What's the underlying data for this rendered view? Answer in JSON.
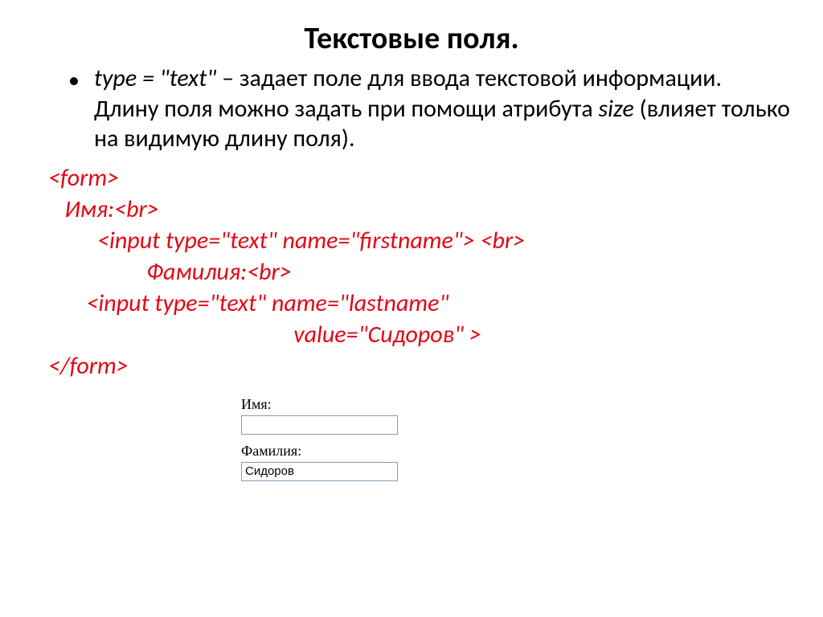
{
  "title": "Текстовые поля.",
  "bullet": {
    "marker": "•",
    "attr": "type = \"text\" ",
    "dash": "– ",
    "text1": "задает поле для ввода текстовой информации. Длину поля можно задать при помощи атрибута ",
    "sizeAttr": "size",
    "text2": " (влияет только на видимую длину поля)."
  },
  "code": {
    "l1": "<form>",
    "l2": "   Имя:<br>",
    "l3": "         <input type=\"text\" name=\"firstname\"> <br>",
    "l4": "                  Фамилия:<br>",
    "l5": "       <input type=\"text\" name=\"lastname\"",
    "l6": "                                             value=\"Сидоров\" >",
    "l7": "</form>"
  },
  "form": {
    "label1": "Имя:",
    "value1": "",
    "label2": "Фамилия:",
    "value2": "Сидоров"
  }
}
